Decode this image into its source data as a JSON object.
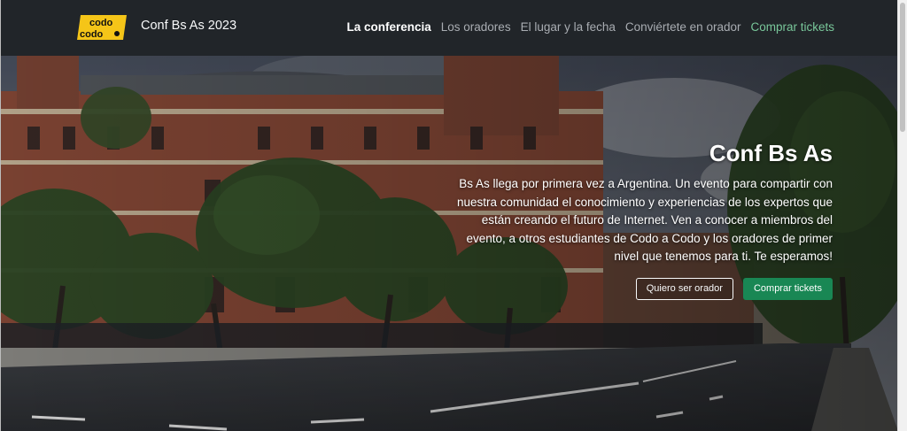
{
  "brand": {
    "logo_line1": "codo",
    "logo_line2": "codo",
    "title": "Conf Bs As 2023"
  },
  "nav": {
    "items": [
      {
        "label": "La conferencia"
      },
      {
        "label": "Los oradores"
      },
      {
        "label": "El lugar y la fecha"
      },
      {
        "label": "Conviértete en orador"
      },
      {
        "label": "Comprar tickets"
      }
    ]
  },
  "hero": {
    "title": "Conf Bs As",
    "text": "Bs As llega por primera vez a Argentina. Un evento para compartir con nuestra comunidad el conocimiento y experiencias de los expertos que están creando el futuro de Internet. Ven a conocer a miembros del evento, a otros estudiantes de Codo a Codo y los oradores de primer nivel que tenemos para ti. Te esperamos!",
    "btn_speaker": "Quiero ser orador",
    "btn_tickets": "Comprar tickets"
  },
  "colors": {
    "navbar_bg": "#212529",
    "accent_green": "#198754",
    "logo_yellow": "#f5c518"
  }
}
